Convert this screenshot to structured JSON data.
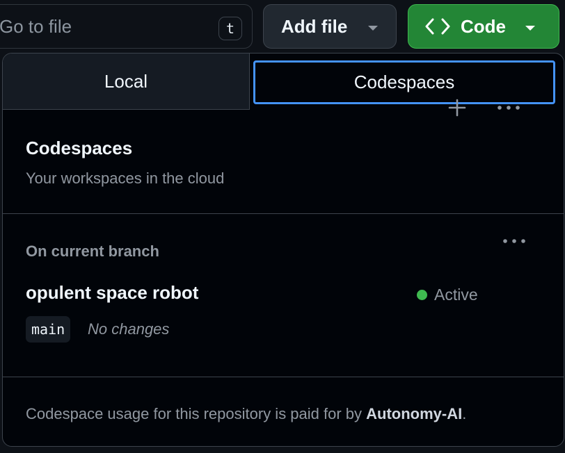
{
  "toolbar": {
    "goto_placeholder": "Go to file",
    "goto_shortcut": "t",
    "add_file_label": "Add file",
    "code_label": "Code"
  },
  "tabs": [
    {
      "label": "Local",
      "selected": false
    },
    {
      "label": "Codespaces",
      "selected": true
    }
  ],
  "codespaces": {
    "title": "Codespaces",
    "subtitle": "Your workspaces in the cloud",
    "section_label": "On current branch",
    "items": [
      {
        "name": "opulent space robot",
        "status": "Active",
        "branch": "main",
        "changes": "No changes"
      }
    ]
  },
  "footer": {
    "prefix": "Codespace usage for this repository is paid for by ",
    "org": "Autonomy-AI",
    "suffix": "."
  },
  "icons": {
    "plus": "plus-icon",
    "more": "kebab-horizontal-icon",
    "code": "code-brackets-icon",
    "caret": "triangle-down-icon"
  },
  "colors": {
    "accent": "#4493f8",
    "primary_button": "#238636",
    "active_status": "#3fb950"
  }
}
